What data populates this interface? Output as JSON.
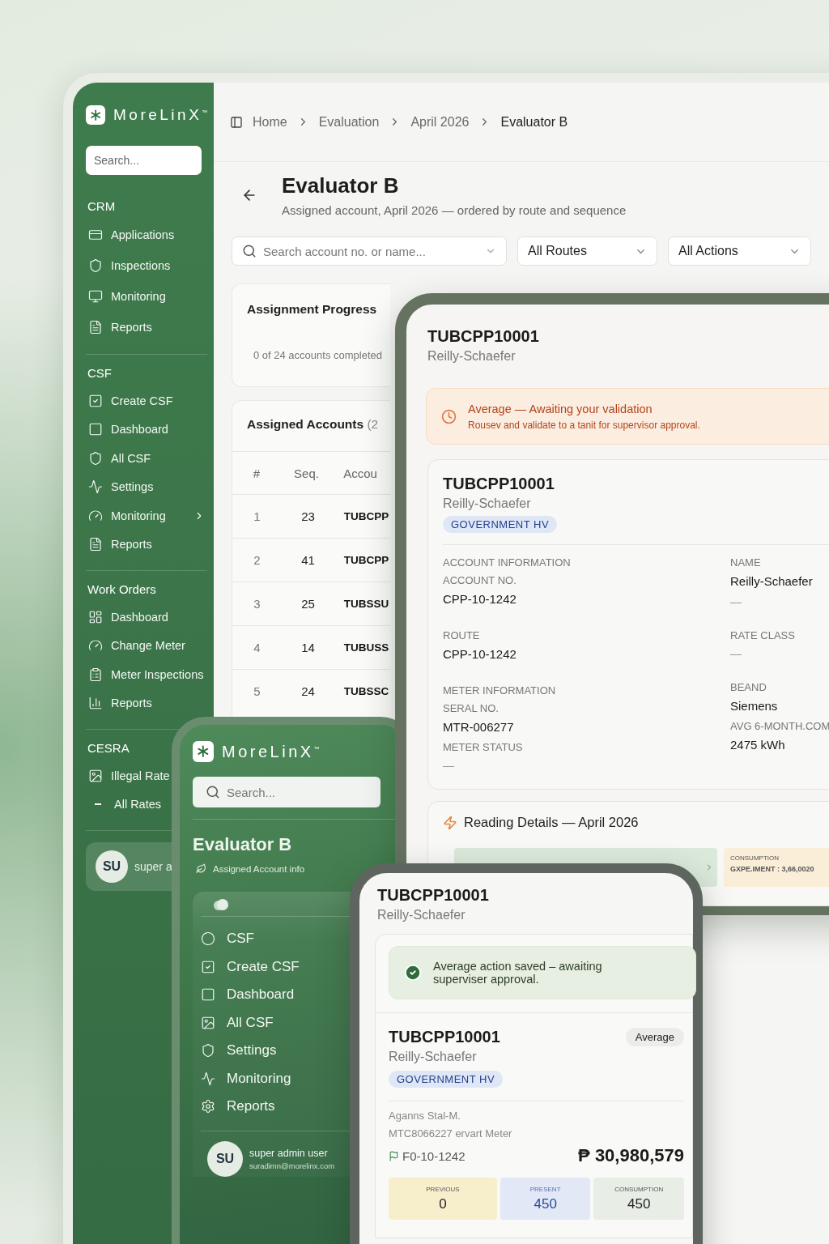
{
  "desktop": {
    "brand": "MoreLinX",
    "brand_mark": "™",
    "search_placeholder": "Search...",
    "sections": [
      {
        "title": "CRM",
        "items": [
          {
            "label": "Applications",
            "kind": "link"
          },
          {
            "label": "Inspections",
            "kind": "link"
          },
          {
            "label": "Monitoring",
            "kind": "link"
          },
          {
            "label": "Reports",
            "kind": "link"
          }
        ]
      },
      {
        "title": "CSF",
        "items": [
          {
            "label": "Create CSF",
            "kind": "link"
          },
          {
            "label": "Dashboard",
            "kind": "link"
          },
          {
            "label": "All CSF",
            "kind": "link"
          },
          {
            "label": "Settings",
            "kind": "link"
          },
          {
            "label": "Monitoring",
            "kind": "expandable"
          },
          {
            "label": "Reports",
            "kind": "link"
          }
        ]
      },
      {
        "title": "Work Orders",
        "items": [
          {
            "label": "Dashboard",
            "kind": "link"
          },
          {
            "label": "Change Meter",
            "kind": "link"
          },
          {
            "label": "Meter Inspections",
            "kind": "link"
          },
          {
            "label": "Reports",
            "kind": "link"
          }
        ]
      },
      {
        "title": "CESRA",
        "items": [
          {
            "label": "Illegal Rate",
            "kind": "link"
          },
          {
            "label": "All Rates",
            "kind": "sub"
          }
        ]
      }
    ],
    "user": {
      "initials": "SU",
      "name": "super a"
    },
    "breadcrumb": [
      "Home",
      "Evaluation",
      "April 2026",
      "Evaluator B"
    ],
    "title": "Evaluator B",
    "subtitle": "Assigned account, April 2026 — ordered by route and sequence",
    "filters": {
      "search_placeholder": "Search account no. or name...",
      "routes": "All Routes",
      "actions": "All Actions"
    },
    "progress": {
      "title": "Assignment Progress",
      "summary": "0 of 24 accounts completed"
    },
    "accounts": {
      "title": "Assigned Accounts",
      "count": "(2",
      "columns": [
        "#",
        "Seq.",
        "Accou"
      ],
      "rows": [
        {
          "num": "1",
          "seq": "23",
          "account": "TUBCPP"
        },
        {
          "num": "2",
          "seq": "41",
          "account": "TUBCPP"
        },
        {
          "num": "3",
          "seq": "25",
          "account": "TUBSSU"
        },
        {
          "num": "4",
          "seq": "14",
          "account": "TUBUSS"
        },
        {
          "num": "5",
          "seq": "24",
          "account": "TUBSSC"
        }
      ]
    }
  },
  "tablet": {
    "account": "TUBCPP10001",
    "name": "Reilly-Schaefer",
    "alert": {
      "kind": "warning",
      "title": "Average — Awaiting your validation",
      "text": "Rousev and validate to a tanit for supervisor approval."
    },
    "card": {
      "account": "TUBCPP10001",
      "name": "Reilly-Schaefer",
      "badge": "GOVERNMENT HV",
      "left": [
        {
          "kind": "heading",
          "text": "ACCOUNT INFORMATION"
        },
        {
          "kind": "label",
          "text": "ACCOUNT NO."
        },
        {
          "kind": "value",
          "text": "CPP-10-1242"
        },
        {
          "kind": "gap"
        },
        {
          "kind": "label",
          "text": "ROUTE"
        },
        {
          "kind": "value",
          "text": "CPP-10-1242"
        },
        {
          "kind": "gap"
        },
        {
          "kind": "heading",
          "text": "METER INFORMATION"
        },
        {
          "kind": "label",
          "text": "SERAL  NO."
        },
        {
          "kind": "value",
          "text": "MTR-006277"
        },
        {
          "kind": "label",
          "text": "METER STATUS"
        },
        {
          "kind": "dash",
          "text": "—"
        }
      ],
      "right": [
        {
          "kind": "label",
          "text": "NAME"
        },
        {
          "kind": "value",
          "text": "Reilly-Schaefer"
        },
        {
          "kind": "dash",
          "text": "—"
        },
        {
          "kind": "gap"
        },
        {
          "kind": "label",
          "text": "RATE CLASS"
        },
        {
          "kind": "dash",
          "text": "—"
        },
        {
          "kind": "gap"
        },
        {
          "kind": "label",
          "text": "BEAND"
        },
        {
          "kind": "value",
          "text": "Siemens"
        },
        {
          "kind": "label",
          "text": "AVG 6-MONTH.COM"
        },
        {
          "kind": "value",
          "text": "2475 kWh"
        }
      ]
    },
    "reading": {
      "title": "Reading Details — April 2026",
      "summary_label": "CONSUMPTION",
      "summary_value": "GXPE.IMENT : 3,66,0020"
    }
  },
  "menu_phone": {
    "brand": "MoreLinX",
    "brand_mark": "™",
    "search_placeholder": "Search...",
    "title": "Evaluator B",
    "subtitle": "Assigned Account info",
    "items": [
      "CSF",
      "Create CSF",
      "Dashboard",
      "All CSF",
      "Settings",
      "Monitoring",
      "Reports"
    ],
    "user": {
      "initials": "SU",
      "name": "super admin user",
      "email": "suradimn@morelinx.com"
    }
  },
  "detail_phone": {
    "account": "TUBCPP10001",
    "name": "Reilly-Schaefer",
    "alert": {
      "kind": "success",
      "text": "Average action saved – awaiting superviser approval."
    },
    "card": {
      "account": "TUBCPP10001",
      "status": "Average",
      "name": "Reilly-Schaefer",
      "badge": "GOVERNMENT HV",
      "meta": [
        "Aganns Stal-M.",
        "MTC8066227 ervart Meter"
      ],
      "route": "F0-10-1242",
      "amount": "₱ 30,980,579",
      "tiles": [
        {
          "kind": "previous",
          "label": "PREVIOUS",
          "value": "0"
        },
        {
          "kind": "present",
          "label": "PRESENT",
          "value": "450"
        },
        {
          "kind": "total",
          "label": "CONSUMPTION",
          "value": "450"
        }
      ]
    }
  }
}
